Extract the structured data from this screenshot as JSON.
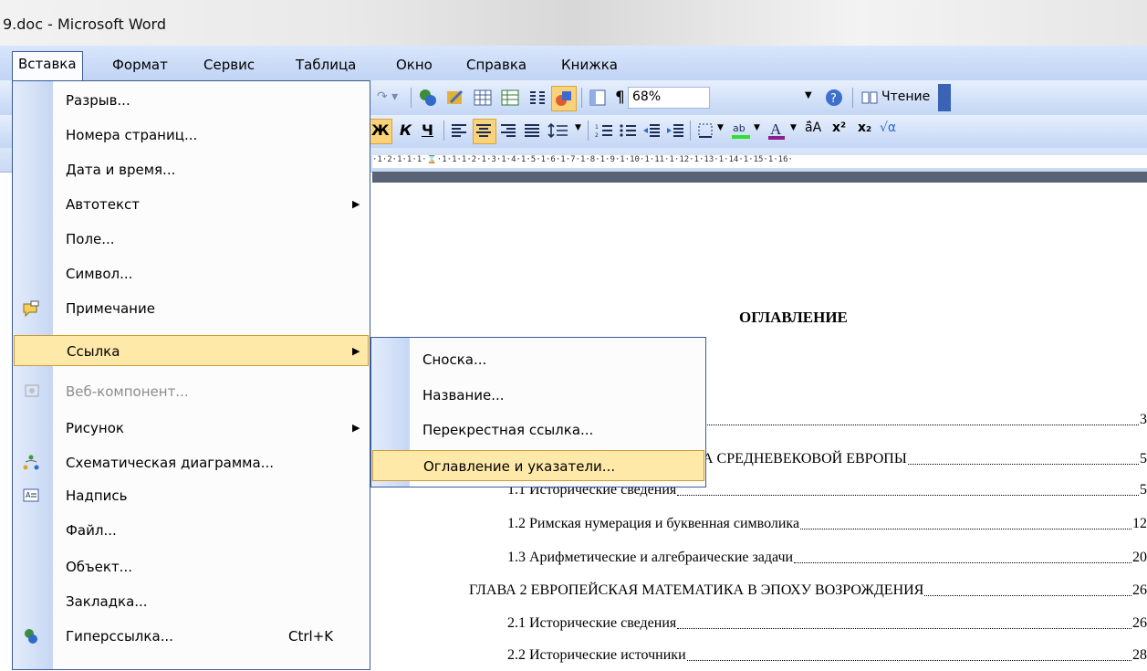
{
  "window": {
    "title": "9.doc - Microsoft Word"
  },
  "menubar": {
    "items": [
      {
        "label": "Вставка",
        "active": true
      },
      {
        "label": "Формат"
      },
      {
        "label": "Сервис"
      },
      {
        "label": "Таблица"
      },
      {
        "label": "Окно"
      },
      {
        "label": "Справка"
      },
      {
        "label": "Книжка"
      }
    ]
  },
  "toolbar": {
    "zoom": "68%",
    "reading_label": "Чтение",
    "bold_glyph": "Ж",
    "italic_glyph": "К",
    "underline_glyph": "Ч",
    "pilcrow": "¶"
  },
  "ruler": {
    "text": "·1·2·1·1·1·⌛·1·1·1·2·1·3·1·4·1·5·1·6·1·7·1·8·1·9·1·10·1·11·1·12·1·13·1·14·1·15·1·16·"
  },
  "insert_menu": {
    "items": [
      {
        "label": "Разрыв..."
      },
      {
        "label": "Номера страниц..."
      },
      {
        "label": "Дата и время..."
      },
      {
        "label": "Автотекст",
        "submenu": true
      },
      {
        "label": "Поле..."
      },
      {
        "label": "Символ..."
      },
      {
        "label": "Примечание",
        "icon": "comment-icon"
      },
      {
        "label": "Ссылка",
        "submenu": true,
        "highlighted": true
      },
      {
        "label": "Веб-компонент...",
        "disabled": true,
        "icon": "web-component-icon"
      },
      {
        "label": "Рисунок",
        "submenu": true
      },
      {
        "label": "Схематическая диаграмма...",
        "icon": "diagram-icon"
      },
      {
        "label": "Надпись",
        "icon": "text-box-icon"
      },
      {
        "label": "Файл..."
      },
      {
        "label": "Объект..."
      },
      {
        "label": "Закладка..."
      },
      {
        "label": "Гиперссылка...",
        "shortcut": "Ctrl+K",
        "icon": "hyperlink-icon"
      }
    ]
  },
  "reference_submenu": {
    "items": [
      {
        "label": "Сноска..."
      },
      {
        "label": "Название..."
      },
      {
        "label": "Перекрестная ссылка..."
      },
      {
        "label": "Оглавление и указатели...",
        "highlighted": true
      }
    ]
  },
  "document": {
    "toc_title": "ОГЛАВЛЕНИЕ",
    "rows": [
      {
        "text": "",
        "page": "3"
      },
      {
        "text": "А СРЕДНЕВЕКОВОЙ ЕВРОПЫ",
        "page": "5"
      },
      {
        "text": "1.1 Исторические сведения",
        "page": "5"
      },
      {
        "text": "1.2  Римская нумерация и буквенная символика",
        "page": "12"
      },
      {
        "text": "1.3 Арифметические и алгебраические задачи",
        "page": "20"
      },
      {
        "text": "ГЛАВА 2 ЕВРОПЕЙСКАЯ МАТЕМАТИКА В ЭПОХУ ВОЗРОЖДЕНИЯ",
        "page": "26"
      },
      {
        "text": "2.1  Исторические сведения",
        "page": "26"
      },
      {
        "text": "2.2 Исторические источники",
        "page": "28"
      }
    ]
  }
}
